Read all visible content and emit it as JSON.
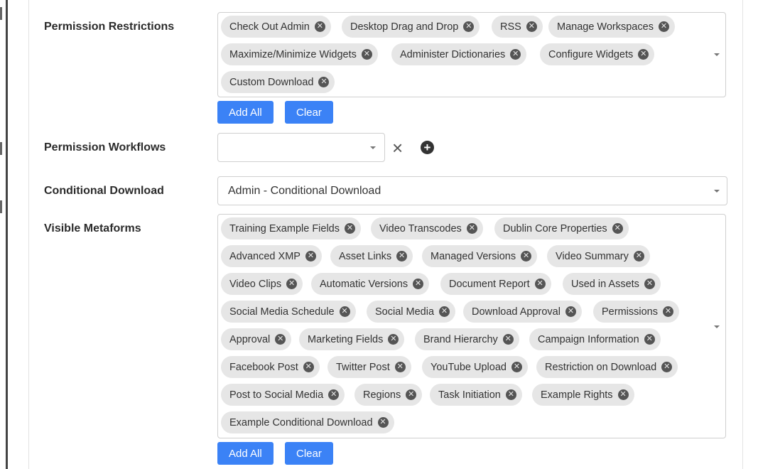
{
  "fields": {
    "permission_restrictions": {
      "label": "Permission Restrictions",
      "tags": [
        "Check Out Admin",
        "Desktop Drag and Drop",
        "RSS",
        "Manage Workspaces",
        "Maximize/Minimize Widgets",
        "Administer Dictionaries",
        "Configure Widgets",
        "Custom Download"
      ],
      "add_all": "Add All",
      "clear": "Clear"
    },
    "permission_workflows": {
      "label": "Permission Workflows",
      "value": ""
    },
    "conditional_download": {
      "label": "Conditional Download",
      "value": "Admin - Conditional Download"
    },
    "visible_metaforms": {
      "label": "Visible Metaforms",
      "tags": [
        "Training Example Fields",
        "Video Transcodes",
        "Dublin Core Properties",
        "Advanced XMP",
        "Asset Links",
        "Managed Versions",
        "Video Summary",
        "Video Clips",
        "Automatic Versions",
        "Document Report",
        "Used in Assets",
        "Social Media Schedule",
        "Social Media",
        "Download Approval",
        "Permissions",
        "Approval",
        "Marketing Fields",
        "Brand Hierarchy",
        "Campaign Information",
        "Facebook Post",
        "Twitter Post",
        "YouTube Upload",
        "Restriction on Download",
        "Post to Social Media",
        "Regions",
        "Task Initiation",
        "Example Rights",
        "Example Conditional Download"
      ],
      "add_all": "Add All",
      "clear": "Clear"
    }
  },
  "icons": {
    "tag_remove": "circle-x-icon",
    "dropdown": "caret-down-icon",
    "clear": "close-icon",
    "add": "plus-circle-icon"
  },
  "colors": {
    "primary_button": "#3b82f6",
    "tag_background": "#e6e6e6"
  }
}
